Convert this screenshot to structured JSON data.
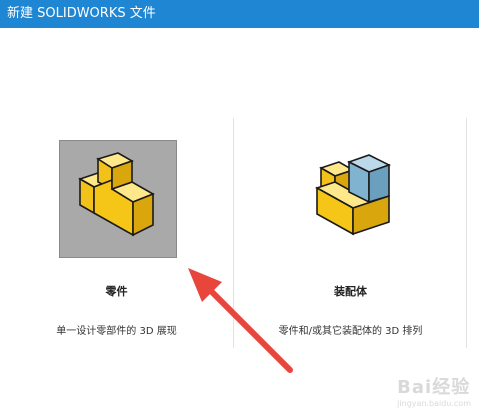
{
  "window": {
    "title": "新建 SOLIDWORKS 文件"
  },
  "options": [
    {
      "label": "零件",
      "description": "单一设计零部件的 3D 展现",
      "icon": "part-cube-icon",
      "selected": true
    },
    {
      "label": "装配体",
      "description": "零件和/或其它装配体的 3D 排列",
      "icon": "assembly-cube-icon",
      "selected": false
    }
  ],
  "annotation": {
    "icon": "red-arrow-icon",
    "color": "#e8463c"
  },
  "watermark": {
    "text": "Bai经验",
    "sub": "jingyan.baidu.com"
  },
  "colors": {
    "titlebar": "#1f86d4",
    "part_yellow": "#f5c518",
    "assembly_blue": "#7fb3d0",
    "selected_tile": "#a9a9a9"
  }
}
